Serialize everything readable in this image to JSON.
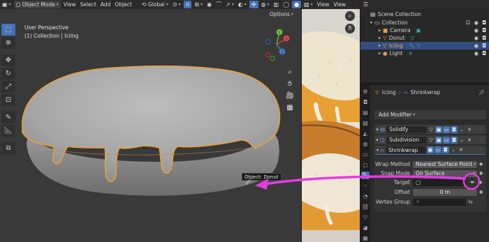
{
  "viewport": {
    "header": {
      "mode": "Object Mode",
      "menus": [
        "View",
        "Select",
        "Add",
        "Object"
      ],
      "transform": "Global"
    },
    "options_label": "Options",
    "title_line1": "User Perspective",
    "title_line2": "(1) Collection | Iciing",
    "tooltip": "Object: Donut",
    "gizmo": {
      "x": "X",
      "y": "Y",
      "z": "Z"
    }
  },
  "image_editor": {
    "menus": [
      "View",
      "View"
    ]
  },
  "outliner": {
    "items": [
      {
        "label": "Scene Collection"
      },
      {
        "label": "Collection"
      },
      {
        "label": "Camera"
      },
      {
        "label": "Donut"
      },
      {
        "label": "Iciing",
        "selected": true
      },
      {
        "label": "Light"
      }
    ]
  },
  "properties": {
    "breadcrumb_object": "Iciing",
    "breadcrumb_modifier": "Shrinkwrap",
    "add_modifier": "Add Modifier",
    "modifiers": [
      {
        "name": "Solidify"
      },
      {
        "name": "Subdivision"
      },
      {
        "name": "Shrinkwrap"
      }
    ],
    "shrinkwrap": {
      "wrap_method_label": "Wrap Method",
      "wrap_method_value": "Nearest Surface Point",
      "snap_mode_label": "Snap Mode",
      "snap_mode_value": "On Surface",
      "target_label": "Target",
      "target_value": "",
      "offset_label": "Offset",
      "offset_value": "0 m",
      "vertex_group_label": "Vertex Group",
      "vertex_group_value": ""
    }
  },
  "colors": {
    "accent_blue": "#4772b3",
    "selection_orange": "#f0a030",
    "annotation_magenta": "#e23de0"
  }
}
